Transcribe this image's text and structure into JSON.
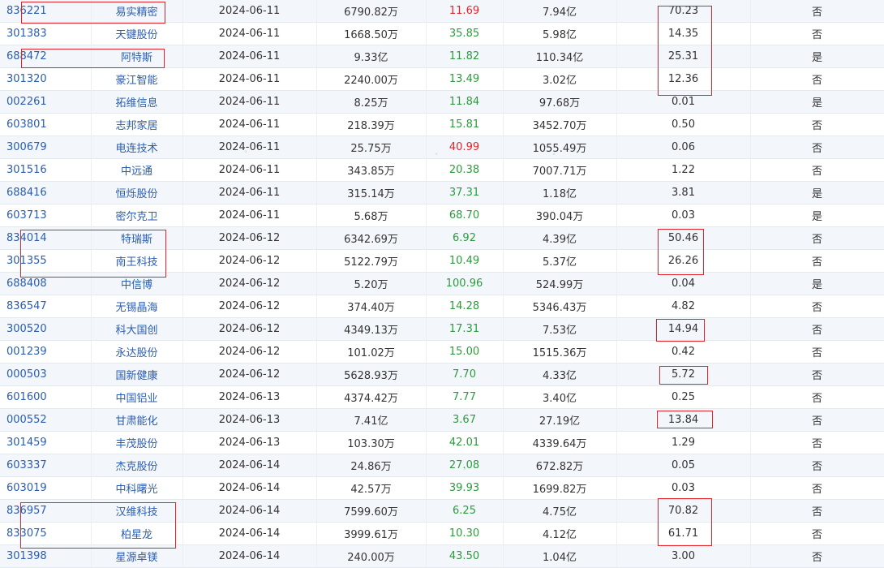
{
  "columns": [
    "code",
    "name",
    "date",
    "amount",
    "change",
    "market_value",
    "ratio",
    "flag"
  ],
  "rows": [
    {
      "code": "836221",
      "name": "易实精密",
      "date": "2024-06-11",
      "amount": "6790.82万",
      "change": "11.69",
      "change_color": "up",
      "market_value": "7.94亿",
      "ratio": "70.23",
      "flag": "否"
    },
    {
      "code": "301383",
      "name": "天键股份",
      "date": "2024-06-11",
      "amount": "1668.50万",
      "change": "35.85",
      "change_color": "down",
      "market_value": "5.98亿",
      "ratio": "14.35",
      "flag": "否"
    },
    {
      "code": "688472",
      "name": "阿特斯",
      "date": "2024-06-11",
      "amount": "9.33亿",
      "change": "11.82",
      "change_color": "down",
      "market_value": "110.34亿",
      "ratio": "25.31",
      "flag": "是"
    },
    {
      "code": "301320",
      "name": "豪江智能",
      "date": "2024-06-11",
      "amount": "2240.00万",
      "change": "13.49",
      "change_color": "down",
      "market_value": "3.02亿",
      "ratio": "12.36",
      "flag": "否"
    },
    {
      "code": "002261",
      "name": "拓维信息",
      "date": "2024-06-11",
      "amount": "8.25万",
      "change": "11.84",
      "change_color": "down",
      "market_value": "97.68万",
      "ratio": "0.01",
      "flag": "是"
    },
    {
      "code": "603801",
      "name": "志邦家居",
      "date": "2024-06-11",
      "amount": "218.39万",
      "change": "15.81",
      "change_color": "down",
      "market_value": "3452.70万",
      "ratio": "0.50",
      "flag": "否"
    },
    {
      "code": "300679",
      "name": "电连技术",
      "date": "2024-06-11",
      "amount": "25.75万",
      "change": "40.99",
      "change_color": "up",
      "market_value": "1055.49万",
      "ratio": "0.06",
      "flag": "否"
    },
    {
      "code": "301516",
      "name": "中远通",
      "date": "2024-06-11",
      "amount": "343.85万",
      "change": "20.38",
      "change_color": "down",
      "market_value": "7007.71万",
      "ratio": "1.22",
      "flag": "否"
    },
    {
      "code": "688416",
      "name": "恒烁股份",
      "date": "2024-06-11",
      "amount": "315.14万",
      "change": "37.31",
      "change_color": "down",
      "market_value": "1.18亿",
      "ratio": "3.81",
      "flag": "是"
    },
    {
      "code": "603713",
      "name": "密尔克卫",
      "date": "2024-06-11",
      "amount": "5.68万",
      "change": "68.70",
      "change_color": "down",
      "market_value": "390.04万",
      "ratio": "0.03",
      "flag": "是"
    },
    {
      "code": "834014",
      "name": "特瑞斯",
      "date": "2024-06-12",
      "amount": "6342.69万",
      "change": "6.92",
      "change_color": "down",
      "market_value": "4.39亿",
      "ratio": "50.46",
      "flag": "否"
    },
    {
      "code": "301355",
      "name": "南王科技",
      "date": "2024-06-12",
      "amount": "5122.79万",
      "change": "10.49",
      "change_color": "down",
      "market_value": "5.37亿",
      "ratio": "26.26",
      "flag": "否"
    },
    {
      "code": "688408",
      "name": "中信博",
      "date": "2024-06-12",
      "amount": "5.20万",
      "change": "100.96",
      "change_color": "down",
      "market_value": "524.99万",
      "ratio": "0.04",
      "flag": "是"
    },
    {
      "code": "836547",
      "name": "无锡晶海",
      "date": "2024-06-12",
      "amount": "374.40万",
      "change": "14.28",
      "change_color": "down",
      "market_value": "5346.43万",
      "ratio": "4.82",
      "flag": "否"
    },
    {
      "code": "300520",
      "name": "科大国创",
      "date": "2024-06-12",
      "amount": "4349.13万",
      "change": "17.31",
      "change_color": "down",
      "market_value": "7.53亿",
      "ratio": "14.94",
      "flag": "否"
    },
    {
      "code": "001239",
      "name": "永达股份",
      "date": "2024-06-12",
      "amount": "101.02万",
      "change": "15.00",
      "change_color": "down",
      "market_value": "1515.36万",
      "ratio": "0.42",
      "flag": "否"
    },
    {
      "code": "000503",
      "name": "国新健康",
      "date": "2024-06-12",
      "amount": "5628.93万",
      "change": "7.70",
      "change_color": "down",
      "market_value": "4.33亿",
      "ratio": "5.72",
      "flag": "否"
    },
    {
      "code": "601600",
      "name": "中国铝业",
      "date": "2024-06-13",
      "amount": "4374.42万",
      "change": "7.77",
      "change_color": "down",
      "market_value": "3.40亿",
      "ratio": "0.25",
      "flag": "否"
    },
    {
      "code": "000552",
      "name": "甘肃能化",
      "date": "2024-06-13",
      "amount": "7.41亿",
      "change": "3.67",
      "change_color": "down",
      "market_value": "27.19亿",
      "ratio": "13.84",
      "flag": "否"
    },
    {
      "code": "301459",
      "name": "丰茂股份",
      "date": "2024-06-13",
      "amount": "103.30万",
      "change": "42.01",
      "change_color": "down",
      "market_value": "4339.64万",
      "ratio": "1.29",
      "flag": "否"
    },
    {
      "code": "603337",
      "name": "杰克股份",
      "date": "2024-06-14",
      "amount": "24.86万",
      "change": "27.08",
      "change_color": "down",
      "market_value": "672.82万",
      "ratio": "0.05",
      "flag": "否"
    },
    {
      "code": "603019",
      "name": "中科曙光",
      "date": "2024-06-14",
      "amount": "42.57万",
      "change": "39.93",
      "change_color": "down",
      "market_value": "1699.82万",
      "ratio": "0.03",
      "flag": "否"
    },
    {
      "code": "836957",
      "name": "汉维科技",
      "date": "2024-06-14",
      "amount": "7599.60万",
      "change": "6.25",
      "change_color": "down",
      "market_value": "4.75亿",
      "ratio": "70.82",
      "flag": "否"
    },
    {
      "code": "833075",
      "name": "柏星龙",
      "date": "2024-06-14",
      "amount": "3999.61万",
      "change": "10.30",
      "change_color": "down",
      "market_value": "4.12亿",
      "ratio": "61.71",
      "flag": "否"
    },
    {
      "code": "301398",
      "name": "星源卓镁",
      "date": "2024-06-14",
      "amount": "240.00万",
      "change": "43.50",
      "change_color": "down",
      "market_value": "1.04亿",
      "ratio": "3.00",
      "flag": "否"
    }
  ],
  "colors": {
    "up": "#e0242a",
    "down": "#2b9b3c",
    "link": "#2a5db0",
    "highlight": "#e0242a"
  }
}
